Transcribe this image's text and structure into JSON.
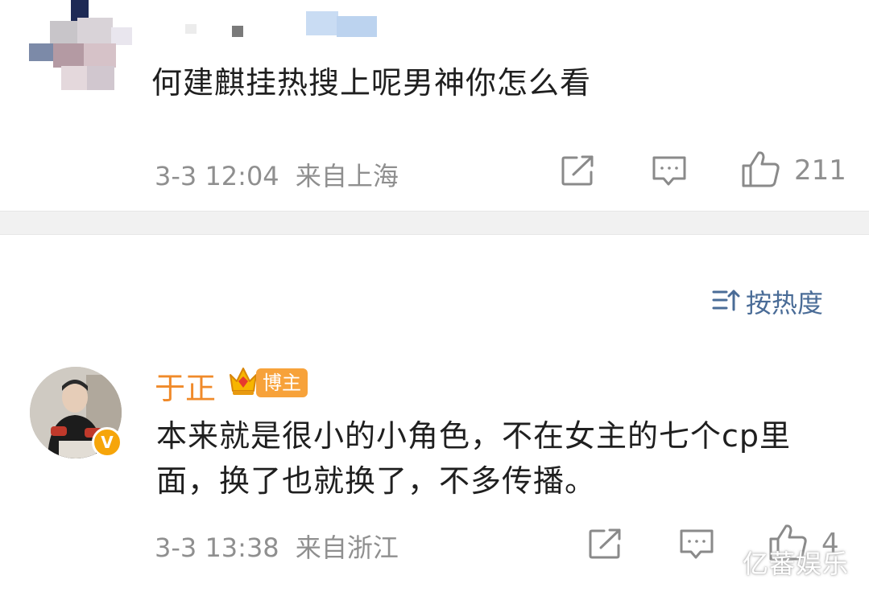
{
  "comments": [
    {
      "text": "何建麒挂热搜上呢男神你怎么看",
      "time": "3-3 12:04",
      "location": "来自上海",
      "like_count": "211",
      "icons": [
        "share-icon",
        "comment-icon",
        "like-icon"
      ]
    },
    {
      "author": "于正",
      "badge_label": "博主",
      "verify_mark": "V",
      "text": "本来就是很小的小角色，不在女主的七个cp里面，换了也就换了，不多传播。",
      "time": "3-3 13:38",
      "location": "来自浙江",
      "like_count": "4",
      "icons": [
        "share-icon",
        "comment-icon",
        "like-icon"
      ]
    }
  ],
  "sort": {
    "label": "按热度",
    "icon": "sort-icon"
  },
  "watermark": "亿蕃娱乐",
  "colors": {
    "author": "#f08a2a",
    "sort": "#4a6c97",
    "meta": "#8f8f8f",
    "badge": "#f7a23a",
    "verify": "#f6a50a"
  }
}
